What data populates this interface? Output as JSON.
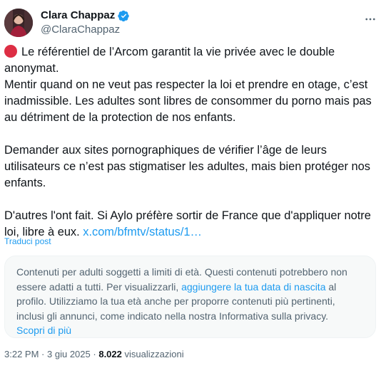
{
  "author": {
    "display_name": "Clara Chappaz",
    "handle": "@ClaraChappaz",
    "verified_icon": "verified-badge-icon",
    "verified_color": "#1d9bf0"
  },
  "more_icon": "more-horizontal-icon",
  "tweet": {
    "p1_icon": "red-circle-icon",
    "p1_line1": "Le référentiel de l’Arcom garantit la vie privée avec le double anonymat.",
    "p1_line2": "Mentir quand on ne veut pas respecter la loi et prendre en otage, c’est inadmissible. Les adultes sont libres de consommer du porno mais pas au détriment de la protection de nos enfants.",
    "p2": "Demander aux sites pornographiques de vérifier l’âge de leurs utilisateurs ce n’est pas stigmatiser les adultes, mais bien protéger nos enfants.",
    "p3_text": "D'autres l'ont fait. Si Aylo préfère sortir de France que d'appliquer notre loi, libre à eux.",
    "p3_link": "x.com/bfmtv/status/1…"
  },
  "translate_label": "Traduci post",
  "age_warning": {
    "text_before": "Contenuti per adulti soggetti a limiti di età. Questi contenuti potrebbero non essere adatti a tutti. Per visualizzarli,",
    "link": "aggiungere la tua data di nascita",
    "text_after": "al profilo. Utilizziamo la tua età anche per proporre contenuti più pertinenti, inclusi gli annunci, come indicato nella nostra Informativa sulla privacy.",
    "learn_more": "Scopri di più"
  },
  "meta": {
    "time": "3:22 PM",
    "separator": "·",
    "date": "3 giu 2025",
    "views_count": "8.022",
    "views_label": "visualizzazioni"
  },
  "colors": {
    "accent": "#1d9bf0",
    "text": "#0f1419",
    "secondary": "#536471",
    "red_circle": "#dd2e44"
  }
}
